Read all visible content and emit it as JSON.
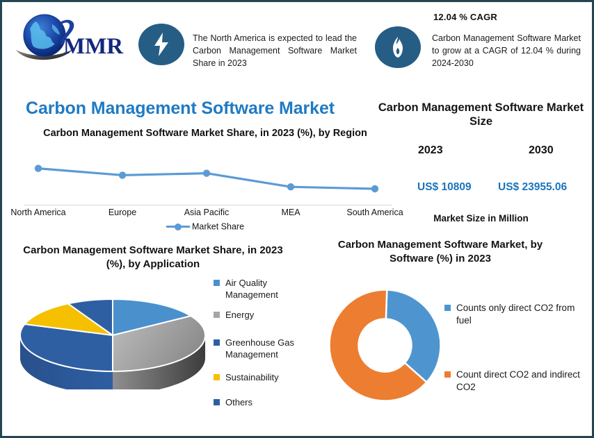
{
  "brand": {
    "name": "MMR",
    "logo_icon": "globe-swoosh-logo"
  },
  "header": {
    "highlight_left": {
      "icon": "lightning-bolt-icon",
      "text": "The North America is expected to lead the Carbon Management Software Market Share in 2023"
    },
    "highlight_right": {
      "icon": "flame-icon",
      "cagr_label": "12.04 % CAGR",
      "text": "Carbon Management Software Market to grow at a CAGR of 12.04 % during 2024-2030"
    }
  },
  "main_title": "Carbon Management Software Market",
  "market_size": {
    "title": "Carbon Management Software Market Size",
    "year_start": "2023",
    "year_end": "2030",
    "value_start": "US$ 10809",
    "value_end": "US$ 23955.06",
    "unit_note": "Market Size in Million",
    "value_color": "#1b74bd"
  },
  "colors": {
    "border": "#24454f",
    "title_blue": "#1f7ac4",
    "line_blue": "#5b9bd5",
    "pie_airquality": "#4a90cd",
    "pie_energy": "#a6a6a6",
    "pie_greenhouse": "#2e5fa3",
    "pie_sustainability": "#f5c000",
    "pie_others": "#2e5fa3",
    "donut_blue": "#4e95d0",
    "donut_orange": "#ed7d31",
    "icon_circle": "#265d85"
  },
  "chart_data": [
    {
      "type": "line",
      "title": "Carbon Management Software Market Share, in 2023 (%), by Region",
      "categories": [
        "North America",
        "Europe",
        "Asia Pacific",
        "MEA",
        "South America"
      ],
      "series": [
        {
          "name": "Market Share",
          "values": [
            36,
            29,
            31,
            17,
            15
          ]
        }
      ],
      "legend": [
        "Market Share"
      ],
      "legend_position": "bottom",
      "xlabel": "",
      "ylabel": "",
      "grid": false,
      "ylim": [
        0,
        40
      ]
    },
    {
      "type": "pie",
      "title": "Carbon Management Software Market Share, in 2023 (%), by Application",
      "three_d": true,
      "categories": [
        "Air Quality Management",
        "Energy",
        "Greenhouse Gas Management",
        "Sustainability",
        "Others"
      ],
      "values": [
        16,
        34,
        30,
        12,
        8
      ],
      "legend": [
        "Air Quality Management",
        "Energy",
        "Greenhouse Gas Management",
        "Sustainability",
        "Others"
      ],
      "legend_position": "right"
    },
    {
      "type": "pie",
      "title": "Carbon Management Software Market, by Software (%) in 2023",
      "donut": true,
      "categories": [
        "Counts only direct CO2 from fuel",
        "Count direct CO2 and indirect CO2"
      ],
      "values": [
        36,
        64
      ],
      "legend": [
        "Counts only direct CO2 from fuel",
        "Count direct CO2 and indirect CO2"
      ],
      "legend_position": "right"
    }
  ]
}
